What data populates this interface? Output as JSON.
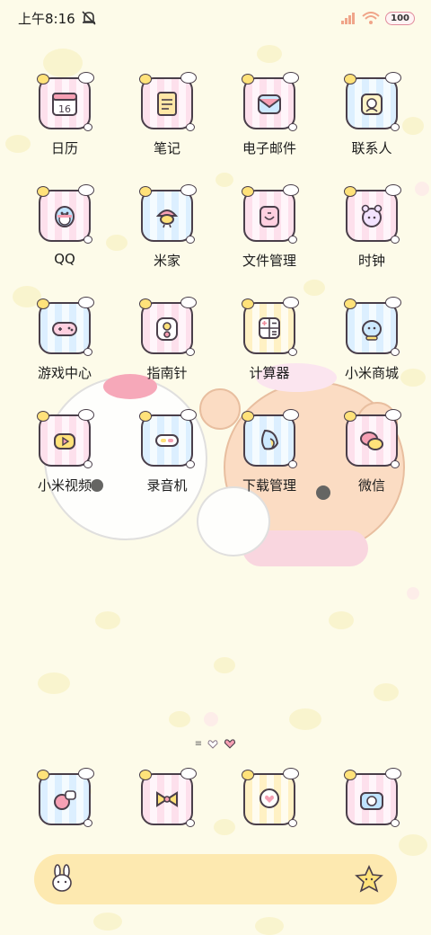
{
  "status_bar": {
    "time": "上午8:16",
    "battery": "100"
  },
  "apps": [
    {
      "label": "日历",
      "icon": "calendar-icon",
      "calendar_day": "16"
    },
    {
      "label": "笔记",
      "icon": "notes-icon"
    },
    {
      "label": "电子邮件",
      "icon": "email-icon"
    },
    {
      "label": "联系人",
      "icon": "contacts-icon"
    },
    {
      "label": "QQ",
      "icon": "qq-penguin-icon"
    },
    {
      "label": "米家",
      "icon": "mijia-icon"
    },
    {
      "label": "文件管理",
      "icon": "file-manager-icon"
    },
    {
      "label": "时钟",
      "icon": "clock-icon"
    },
    {
      "label": "游戏中心",
      "icon": "gamepad-icon"
    },
    {
      "label": "指南针",
      "icon": "compass-icon"
    },
    {
      "label": "计算器",
      "icon": "calculator-icon"
    },
    {
      "label": "小米商城",
      "icon": "mi-store-icon"
    },
    {
      "label": "小米视频",
      "icon": "video-icon"
    },
    {
      "label": "录音机",
      "icon": "recorder-icon"
    },
    {
      "label": "下载管理",
      "icon": "download-icon"
    },
    {
      "label": "微信",
      "icon": "wechat-icon"
    }
  ],
  "dock": [
    {
      "icon": "gallery-icon"
    },
    {
      "icon": "theme-bow-icon"
    },
    {
      "icon": "messages-icon"
    },
    {
      "icon": "camera-icon"
    }
  ],
  "search_bar": {
    "left_icon": "bunny-icon",
    "right_icon": "star-face-icon"
  }
}
